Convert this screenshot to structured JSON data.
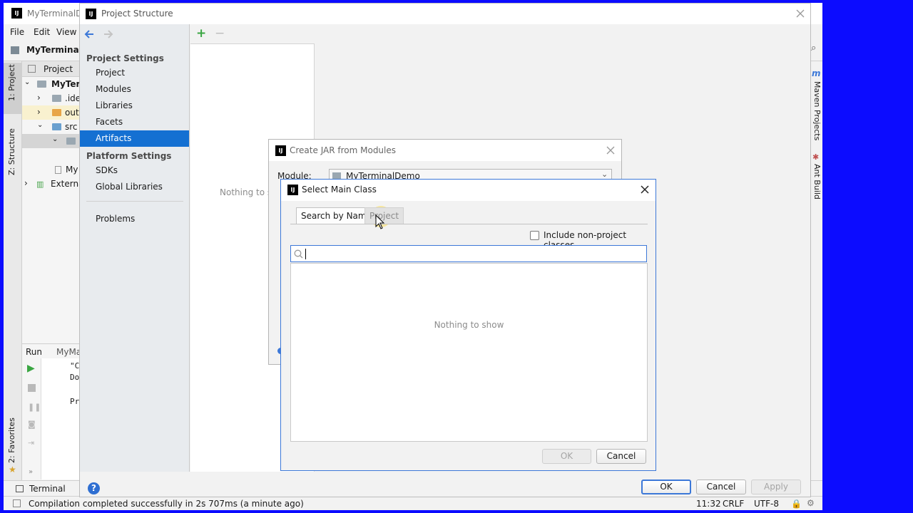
{
  "ide": {
    "title": "MyTerminalDemo",
    "menu": [
      "File",
      "Edit",
      "View"
    ],
    "breadcrumb": "MyTerminalD",
    "project_tab": "Project",
    "left_stripe": {
      "project": "1: Project",
      "structure": "Z: Structure",
      "favorites": "2: Favorites"
    },
    "tree": {
      "root": "MyTerm",
      "idea": ".ide",
      "out": "out",
      "src": "src",
      "file": "My",
      "external": "External"
    },
    "run": {
      "tab_label": "Run",
      "config": "MyMa",
      "console_lines": [
        "\"C",
        "Do",
        "Pr"
      ]
    },
    "right_stripe": {
      "maven": "Maven Projects",
      "ant": "Ant Build",
      "maven_badge": "m"
    },
    "bottom_tab": "Terminal",
    "status": {
      "message": "Compilation completed successfully in 2s 707ms (a minute ago)",
      "position": "11:32",
      "line_sep": "CRLF",
      "encoding": "UTF-8"
    }
  },
  "project_structure": {
    "title": "Project Structure",
    "project_settings_header": "Project Settings",
    "project_settings_items": [
      "Project",
      "Modules",
      "Libraries",
      "Facets",
      "Artifacts"
    ],
    "selected_item": "Artifacts",
    "platform_settings_header": "Platform Settings",
    "platform_settings_items": [
      "SDKs",
      "Global Libraries"
    ],
    "problems": "Problems",
    "mid_empty": "Nothing to sh",
    "ok": "OK",
    "cancel": "Cancel",
    "apply": "Apply"
  },
  "create_jar": {
    "title": "Create JAR from Modules",
    "module_label": "Module:",
    "module_value": "MyTerminalDemo"
  },
  "select_main_class": {
    "title": "Select Main Class",
    "tabs": [
      "Search by Name",
      "Project"
    ],
    "active_tab": "Search by Name",
    "include_non_project": "Include non-project classes",
    "include_non_project_checked": false,
    "search_value": "",
    "empty_text": "Nothing to show",
    "ok": "OK",
    "cancel": "Cancel"
  },
  "colors": {
    "selection": "#1470d2",
    "focus": "#3c78d8",
    "background": "#0c0cff",
    "run_green": "#3aa642"
  }
}
